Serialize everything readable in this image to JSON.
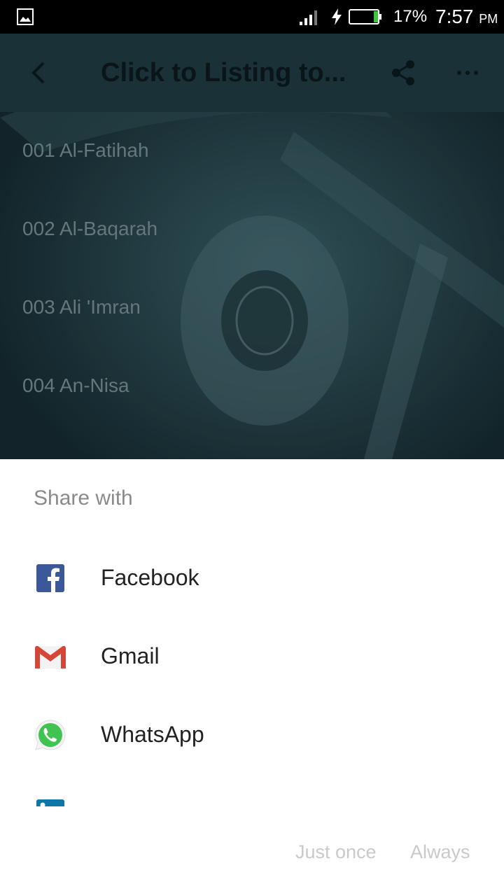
{
  "status_bar": {
    "battery_percent": "17%",
    "time": "7:57",
    "ampm": "PM"
  },
  "toolbar": {
    "title": "Click to  Listing to..."
  },
  "surah_list": {
    "items": [
      "001 Al-Fatihah",
      "002 Al-Baqarah",
      "003 Ali 'Imran",
      "004 An-Nisa"
    ]
  },
  "share_sheet": {
    "title": "Share with",
    "apps": [
      {
        "label": "Facebook",
        "icon": "facebook-icon"
      },
      {
        "label": "Gmail",
        "icon": "gmail-icon"
      },
      {
        "label": "WhatsApp",
        "icon": "whatsapp-icon"
      },
      {
        "label": "",
        "icon": "linkedin-icon"
      }
    ],
    "just_once_label": "Just once",
    "always_label": "Always"
  }
}
